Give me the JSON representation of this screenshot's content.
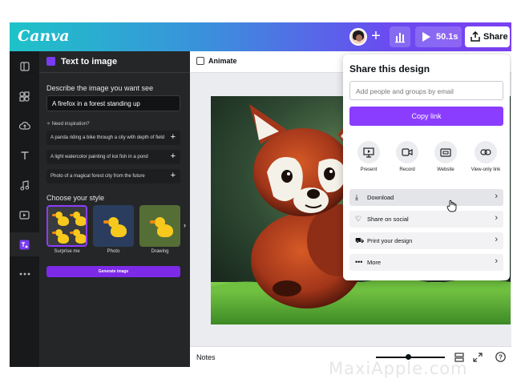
{
  "topbar": {
    "logo": "Canva",
    "timer": "50.1s",
    "share_label": "Share"
  },
  "panel": {
    "title": "Text to image",
    "describe_label": "Describe the image you want see",
    "describe_value": "A firefox in a forest standing up",
    "inspiration_label": "Need inspiration?",
    "suggestions": [
      "A panda riding a bike through a city with depth of field",
      "A light watercolor painting of koi fish in a pond",
      "Photo of a magical forest city from the future"
    ],
    "style_label": "Choose your style",
    "styles": [
      "Surprise me",
      "Photo",
      "Drawing"
    ],
    "generate_label": "Generate image"
  },
  "canvas": {
    "animate_label": "Animate",
    "notes_label": "Notes",
    "zoom_fraction": 0.47
  },
  "share_popup": {
    "title": "Share this design",
    "email_placeholder": "Add people and groups by email",
    "copy_link_label": "Copy link",
    "options": [
      "Present",
      "Record",
      "Website",
      "View-only link"
    ],
    "rows": [
      "Download",
      "Share on social",
      "Print your design",
      "More"
    ]
  },
  "watermark": "MaxiApple.com",
  "colors": {
    "accent": "#8b3dff",
    "rail": "#18191b",
    "panel": "#252627"
  }
}
